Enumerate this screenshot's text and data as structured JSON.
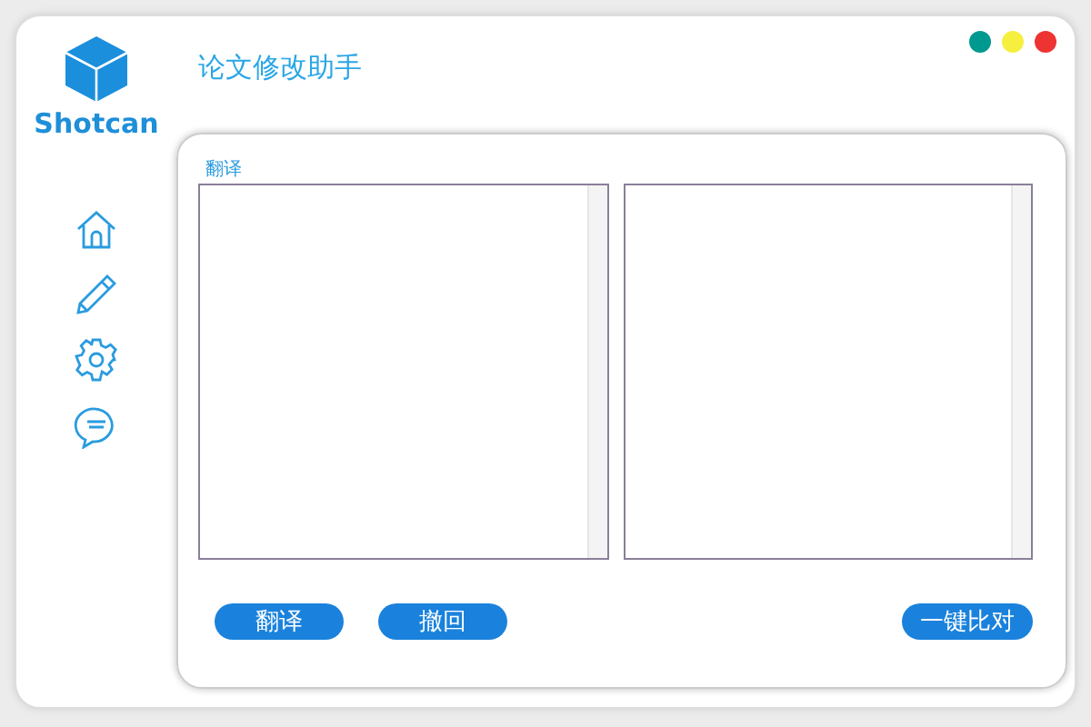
{
  "window": {
    "title": "论文修改助手",
    "controls": [
      {
        "color": "#00998f"
      },
      {
        "color": "#f7ef3f"
      },
      {
        "color": "#ee3333"
      }
    ]
  },
  "sidebar": {
    "logo": "Shotcan",
    "items": [
      {
        "kind": "home"
      },
      {
        "kind": "edit"
      },
      {
        "kind": "settings"
      },
      {
        "kind": "chat"
      }
    ]
  },
  "panel": {
    "label": "翻译",
    "buttons": [
      {
        "label": "翻译"
      },
      {
        "label": "撤回"
      },
      {
        "label": "一键比对"
      }
    ]
  }
}
